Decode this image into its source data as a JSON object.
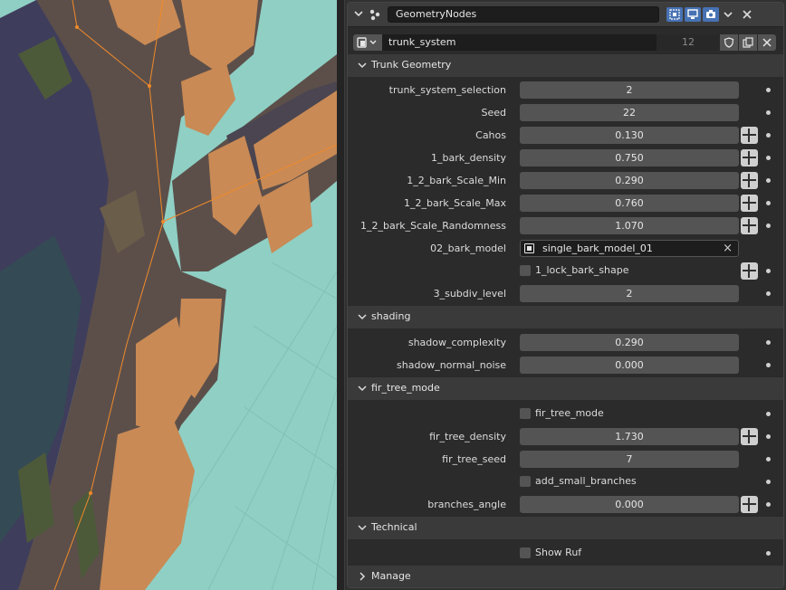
{
  "modifier": {
    "name": "GeometryNodes",
    "node_group": "trunk_system",
    "users": "12"
  },
  "sections": {
    "trunk_geometry": "Trunk Geometry",
    "shading": "shading",
    "fir_tree_mode": "fir_tree_mode",
    "technical": "Technical",
    "manage": "Manage"
  },
  "inputs": {
    "trunk_system_selection": {
      "label": "trunk_system_selection",
      "value": "2"
    },
    "seed": {
      "label": "Seed",
      "value": "22"
    },
    "cahos": {
      "label": "Cahos",
      "value": "0.130"
    },
    "bark_density": {
      "label": "1_bark_density",
      "value": "0.750"
    },
    "bark_scale_min": {
      "label": "1_2_bark_Scale_Min",
      "value": "0.290"
    },
    "bark_scale_max": {
      "label": "1_2_bark_Scale_Max",
      "value": "0.760"
    },
    "bark_scale_randomness": {
      "label": "1_2_bark_Scale_Randomness",
      "value": "1.070"
    },
    "bark_model": {
      "label": "02_bark_model",
      "value": "single_bark_model_01"
    },
    "lock_bark_shape": {
      "label": "1_lock_bark_shape",
      "checked": false
    },
    "subdiv_level": {
      "label": "3_subdiv_level",
      "value": "2"
    },
    "shadow_complexity": {
      "label": "shadow_complexity",
      "value": "0.290"
    },
    "shadow_normal_noise": {
      "label": "shadow_normal_noise",
      "value": "0.000"
    },
    "fir_tree_mode": {
      "label": "fir_tree_mode",
      "checked": false
    },
    "fir_tree_density": {
      "label": "fir_tree_density",
      "value": "1.730"
    },
    "fir_tree_seed": {
      "label": "fir_tree_seed",
      "value": "7"
    },
    "add_small_branches": {
      "label": "add_small_branches",
      "checked": false
    },
    "branches_angle": {
      "label": "branches_angle",
      "value": "0.000"
    },
    "show_ruf": {
      "label": "Show Ruf",
      "checked": false
    }
  },
  "colors": {
    "viewport_bg": "#8fcfc4",
    "bark_light": "#c98a55",
    "bark_mid": "#5c4f4a",
    "bark_shadow": "#3f3d5c",
    "edge": "#f08a2a",
    "accent": "#4772b3"
  }
}
